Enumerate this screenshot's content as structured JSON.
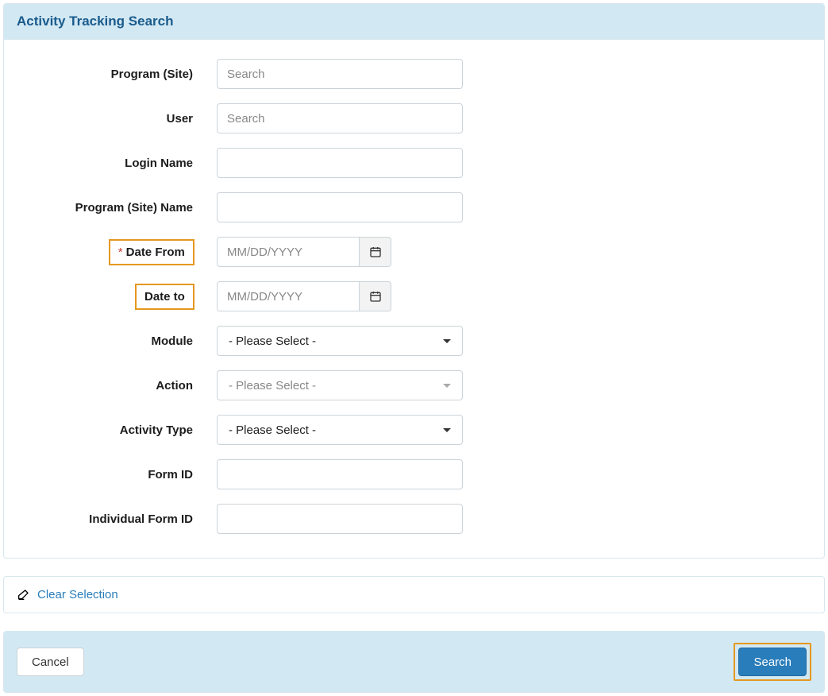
{
  "header": {
    "title": "Activity Tracking Search"
  },
  "labels": {
    "program_site": "Program (Site)",
    "user": "User",
    "login_name": "Login Name",
    "program_site_name": "Program (Site) Name",
    "date_from": "Date From",
    "date_to": "Date to",
    "module": "Module",
    "action": "Action",
    "activity_type": "Activity Type",
    "form_id": "Form ID",
    "individual_form_id": "Individual Form ID"
  },
  "placeholders": {
    "search": "Search",
    "date": "MM/DD/YYYY"
  },
  "selects": {
    "please_select": "- Please Select -"
  },
  "values": {
    "program_site": "",
    "user": "",
    "login_name": "",
    "program_site_name": "",
    "date_from": "",
    "date_to": "",
    "module": "- Please Select -",
    "action": "- Please Select -",
    "activity_type": "- Please Select -",
    "form_id": "",
    "individual_form_id": ""
  },
  "actions": {
    "clear_selection": "Clear Selection",
    "cancel": "Cancel",
    "search": "Search"
  },
  "required_marker": "*"
}
